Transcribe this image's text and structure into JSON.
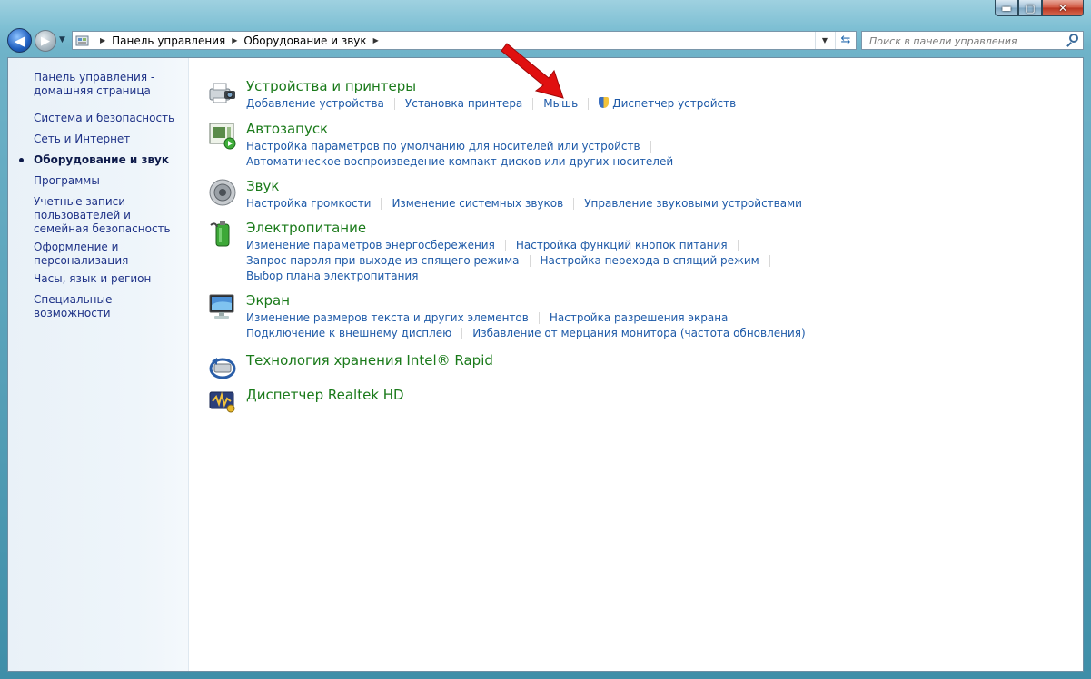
{
  "window": {
    "caption_buttons": {
      "minimize": "▬",
      "maximize": "▢",
      "close": "✕"
    }
  },
  "nav": {
    "back_icon": "◀",
    "forward_icon": "▶",
    "breadcrumb": [
      "Панель управления",
      "Оборудование и звук"
    ],
    "search_placeholder": "Поиск в панели управления"
  },
  "sidebar": {
    "items": [
      {
        "label": "Панель управления - домашняя страница"
      },
      {
        "label": "Система и безопасность"
      },
      {
        "label": "Сеть и Интернет"
      },
      {
        "label": "Оборудование и звук",
        "active": true
      },
      {
        "label": "Программы"
      },
      {
        "label": "Учетные записи пользователей и семейная безопасность"
      },
      {
        "label": "Оформление и персонализация"
      },
      {
        "label": "Часы, язык и регион"
      },
      {
        "label": "Специальные возможности"
      }
    ]
  },
  "sections": [
    {
      "title": "Устройства и принтеры",
      "icon": "printer-camera-icon",
      "links": [
        [
          "Добавление устройства",
          "Установка принтера",
          "Мышь",
          "Диспетчер устройств"
        ]
      ]
    },
    {
      "title": "Автозапуск",
      "icon": "autoplay-icon",
      "links": [
        [
          "Настройка параметров по умолчанию для носителей или устройств"
        ],
        [
          "Автоматическое воспроизведение компакт-дисков или других носителей"
        ]
      ]
    },
    {
      "title": "Звук",
      "icon": "speaker-icon",
      "links": [
        [
          "Настройка громкости",
          "Изменение системных звуков",
          "Управление звуковыми устройствами"
        ]
      ]
    },
    {
      "title": "Электропитание",
      "icon": "battery-icon",
      "links": [
        [
          "Изменение параметров энергосбережения",
          "Настройка функций кнопок питания"
        ],
        [
          "Запрос пароля при выходе из спящего режима",
          "Настройка перехода в спящий режим"
        ],
        [
          "Выбор плана электропитания"
        ]
      ]
    },
    {
      "title": "Экран",
      "icon": "monitor-icon",
      "links": [
        [
          "Изменение размеров текста и других элементов",
          "Настройка разрешения экрана"
        ],
        [
          "Подключение к внешнему дисплею",
          "Избавление от мерцания монитора (частота обновления)"
        ]
      ]
    },
    {
      "title": "Технология хранения Intel® Rapid",
      "icon": "intel-storage-icon",
      "links": []
    },
    {
      "title": "Диспетчер Realtek HD",
      "icon": "realtek-audio-icon",
      "links": []
    }
  ],
  "colors": {
    "section_title": "#1a7a1a",
    "link": "#1e5aa8",
    "sidebar_link": "#1e3287",
    "annotation_arrow": "#e01010"
  }
}
